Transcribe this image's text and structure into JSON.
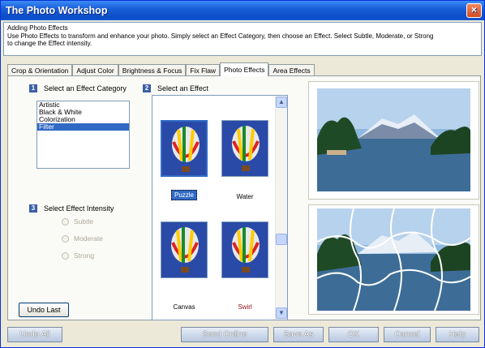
{
  "window": {
    "title": "The Photo Workshop",
    "close_glyph": "×"
  },
  "info": {
    "heading": "Adding Photo Effects",
    "line1": "Use Photo Effects to transform and enhance your photo.  Simply select an Effect Category, then choose an Effect.  Select Subtle, Moderate, or Strong",
    "line2": "to change the Effect intensity."
  },
  "tabs": [
    "Crop & Orientation",
    "Adjust Color",
    "Brightness & Focus",
    "Fix Flaw",
    "Photo Effects",
    "Area Effects"
  ],
  "active_tab": "Photo Effects",
  "step1": {
    "num": "1",
    "label": "Select an Effect Category"
  },
  "categories": [
    "Artistic",
    "Black & White",
    "Colorization",
    "Filter"
  ],
  "selected_category": "Filter",
  "step2": {
    "num": "2",
    "label": "Select an Effect"
  },
  "effects": [
    "Puzzle",
    "Water",
    "Canvas",
    "Swirl"
  ],
  "selected_effect": "Puzzle",
  "step3": {
    "num": "3",
    "label": "Select Effect Intensity"
  },
  "intensity": [
    "Subtle",
    "Moderate",
    "Strong"
  ],
  "undo_last": "Undo Last",
  "buttons": {
    "undo_all": "Undo All",
    "send_online": "Send Online",
    "save_as": "Save As",
    "ok": "OK",
    "cancel": "Cancel",
    "help": "Help"
  },
  "scroll": {
    "up": "▲",
    "down": "▼"
  },
  "colors": {
    "title_bar": "#0a4cc6",
    "selection": "#316ac5",
    "accent_button": "#b8c9e0"
  }
}
